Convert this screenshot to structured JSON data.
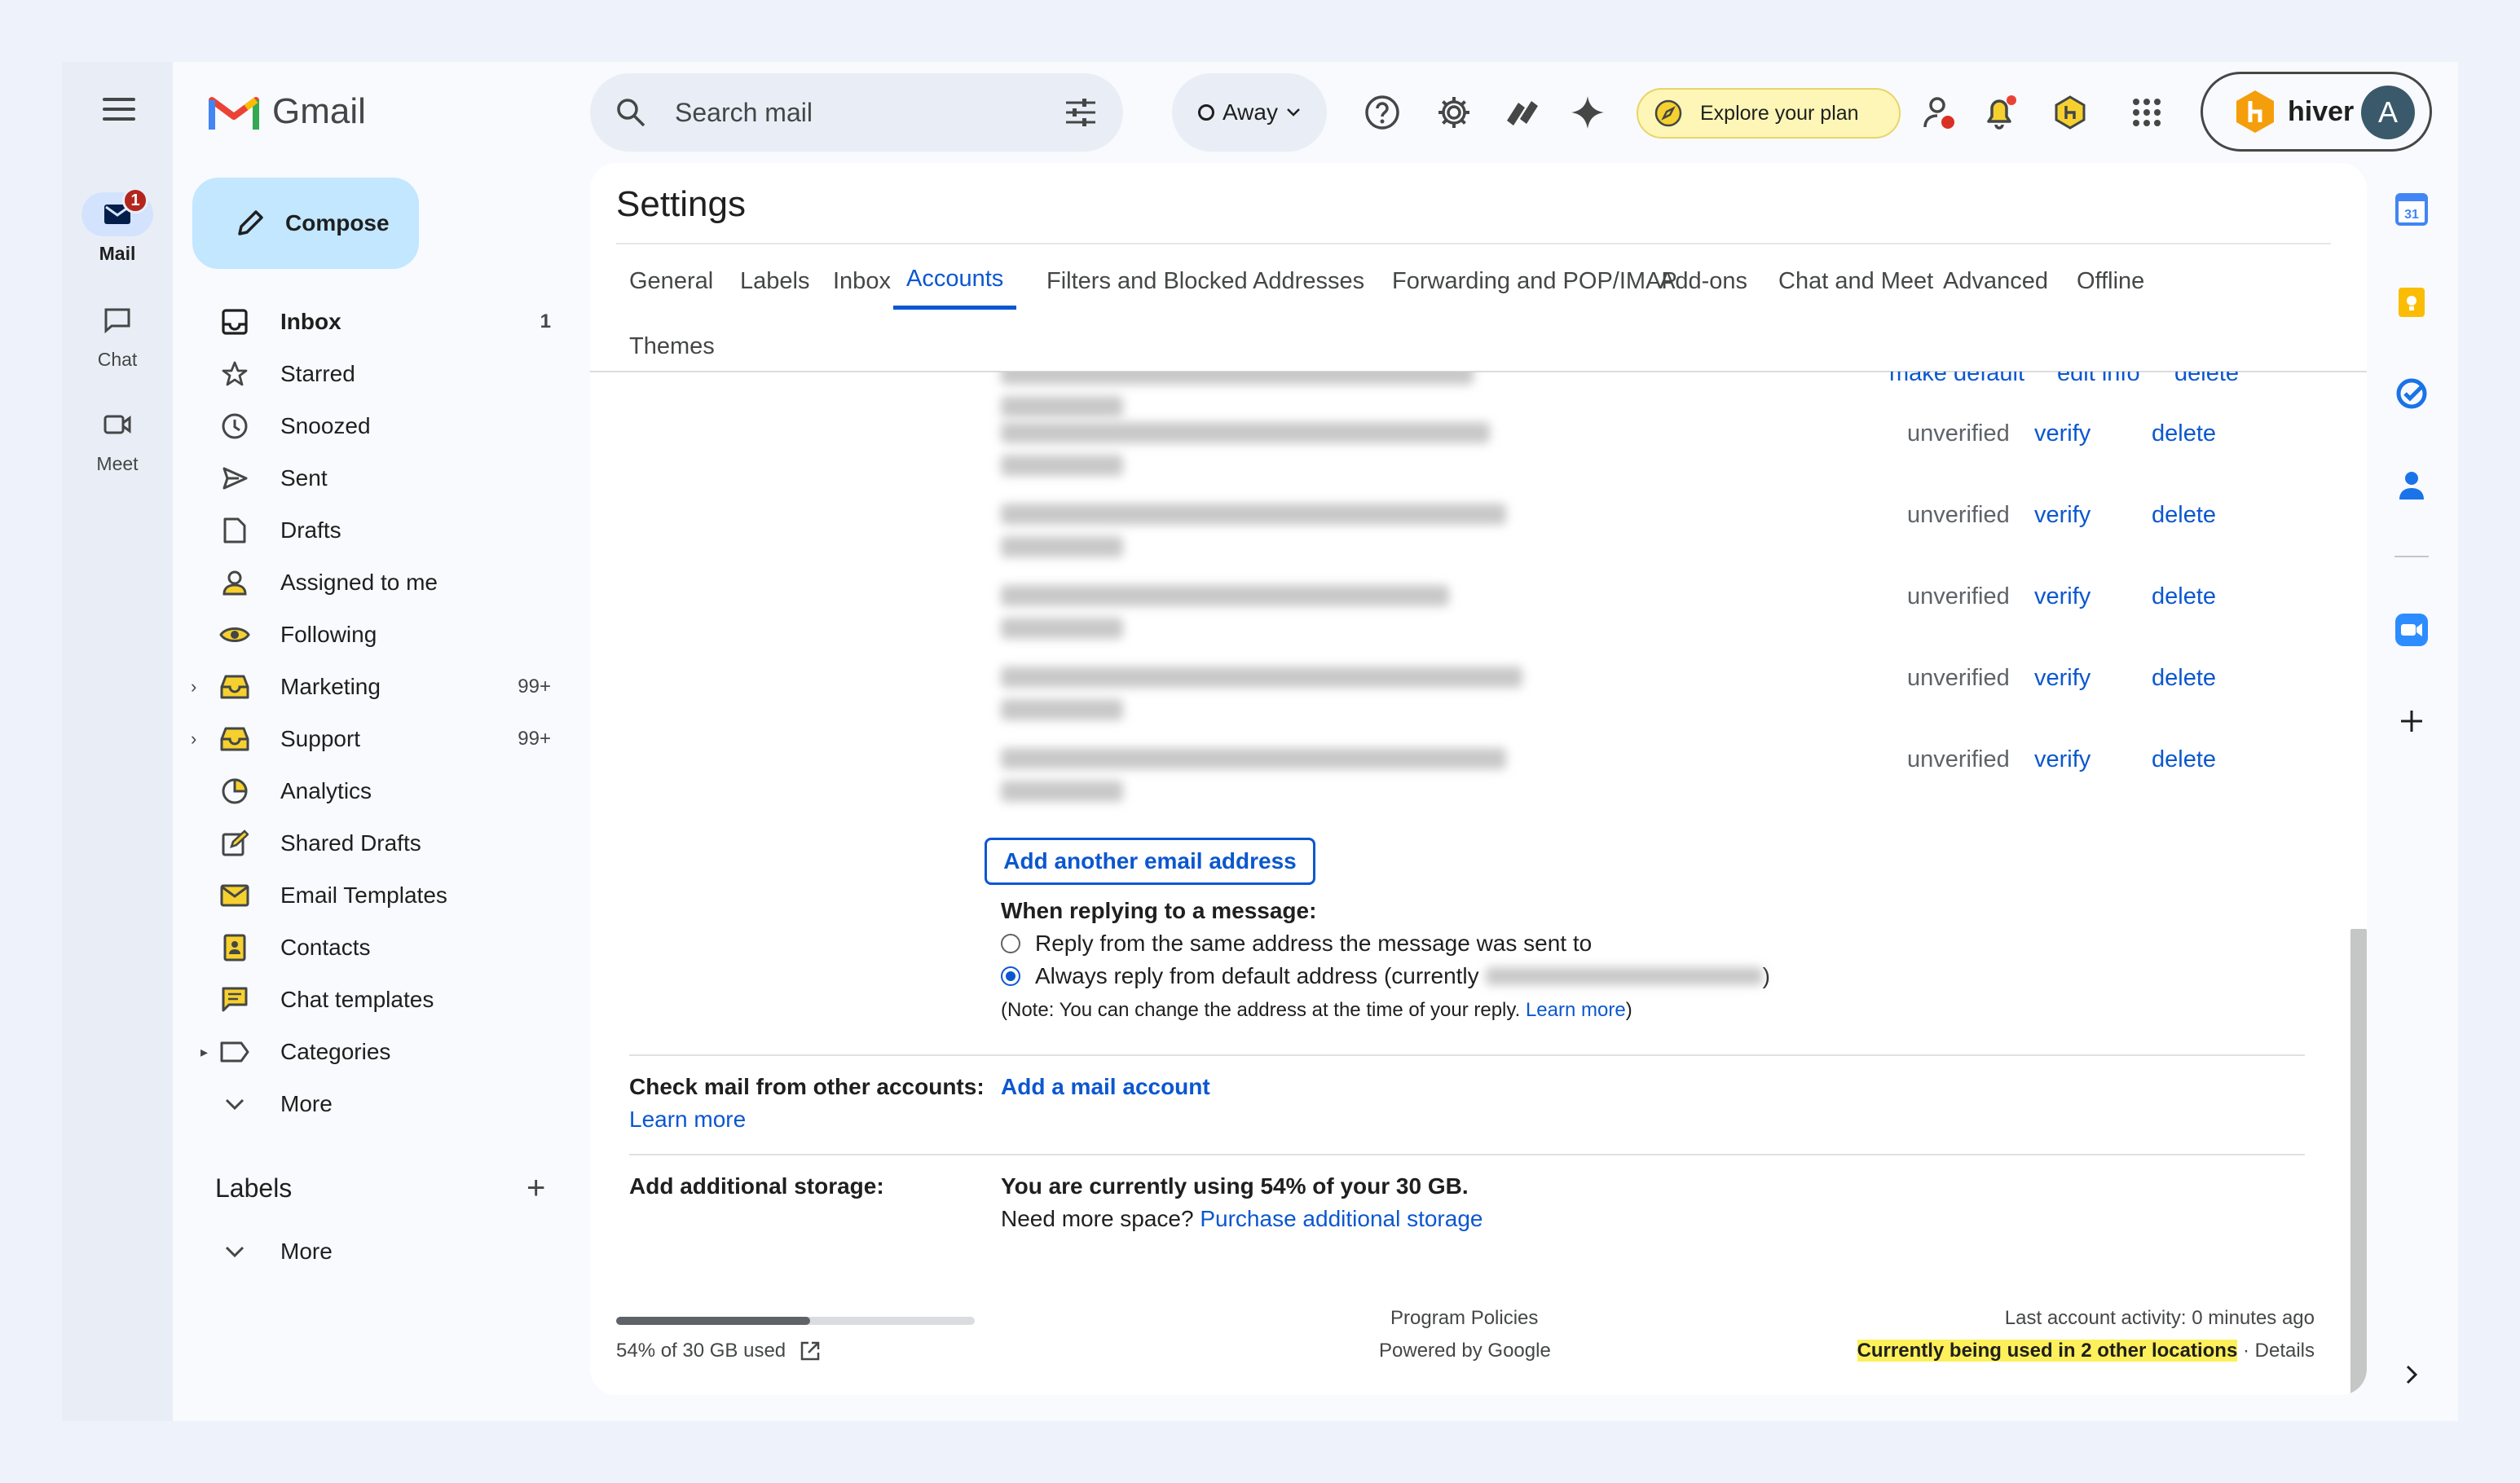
{
  "rail": {
    "items": [
      {
        "label": "Mail",
        "badge": "1"
      },
      {
        "label": "Chat"
      },
      {
        "label": "Meet"
      }
    ]
  },
  "brand": {
    "name": "Gmail"
  },
  "compose": {
    "label": "Compose"
  },
  "nav": [
    {
      "label": "Inbox",
      "count": "1",
      "icon": "inbox-icon"
    },
    {
      "label": "Starred",
      "icon": "star-icon"
    },
    {
      "label": "Snoozed",
      "icon": "clock-icon"
    },
    {
      "label": "Sent",
      "icon": "send-icon"
    },
    {
      "label": "Drafts",
      "icon": "draft-icon"
    },
    {
      "label": "Assigned to me",
      "icon": "person-icon"
    },
    {
      "label": "Following",
      "icon": "eye-icon"
    },
    {
      "label": "Marketing",
      "count": "99+",
      "icon": "tray-icon"
    },
    {
      "label": "Support",
      "count": "99+",
      "icon": "tray-icon"
    },
    {
      "label": "Analytics",
      "icon": "pie-icon"
    },
    {
      "label": "Shared Drafts",
      "icon": "edit-icon"
    },
    {
      "label": "Email Templates",
      "icon": "mail-icon"
    },
    {
      "label": "Contacts",
      "icon": "contacts-icon"
    },
    {
      "label": "Chat templates",
      "icon": "chat-icon"
    },
    {
      "label": "Categories",
      "icon": "label-icon"
    },
    {
      "label": "More",
      "icon": "chevron-down-icon"
    }
  ],
  "labels": {
    "title": "Labels",
    "more": "More"
  },
  "search": {
    "placeholder": "Search mail"
  },
  "status": {
    "label": "Away"
  },
  "explore": {
    "label": "Explore your plan"
  },
  "hiver": {
    "brand": "hiver",
    "avatar": "A"
  },
  "settings": {
    "title": "Settings",
    "tabs": [
      "General",
      "Labels",
      "Inbox",
      "Accounts",
      "Filters and Blocked Addresses",
      "Forwarding and POP/IMAP",
      "Add-ons",
      "Chat and Meet",
      "Advanced",
      "Offline",
      "Themes"
    ],
    "active_tab": "Accounts",
    "top_links": [
      "make default",
      "edit info",
      "delete"
    ],
    "addresses": [
      {
        "status": "unverified",
        "verify": "verify",
        "delete": "delete"
      },
      {
        "status": "unverified",
        "verify": "verify",
        "delete": "delete"
      },
      {
        "status": "unverified",
        "verify": "verify",
        "delete": "delete"
      },
      {
        "status": "unverified",
        "verify": "verify",
        "delete": "delete"
      },
      {
        "status": "unverified",
        "verify": "verify",
        "delete": "delete"
      }
    ],
    "add_email_button": "Add another email address",
    "reply_heading": "When replying to a message:",
    "reply_option_1": "Reply from the same address the message was sent to",
    "reply_option_2_prefix": "Always reply from default address (currently",
    "reply_option_2_suffix": ")",
    "note": "(Note: You can change the address at the time of your reply.",
    "note_link": "Learn more",
    "note_close": ")",
    "check_mail_label": "Check mail from other accounts:",
    "check_mail_learn": "Learn more",
    "add_mail_account": "Add a mail account",
    "storage_label": "Add additional storage:",
    "storage_usage": "You are currently using 54% of your 30 GB.",
    "storage_need": "Need more space?",
    "storage_link": "Purchase additional storage"
  },
  "footer": {
    "usage_percent": 54,
    "usage_text": "54% of 30 GB used",
    "program_policies": "Program Policies",
    "powered_by": "Powered by Google",
    "last_activity": "Last account activity: 0 minutes ago",
    "locations": "Currently being used in 2 other locations",
    "details_sep": "·",
    "details": "Details"
  }
}
